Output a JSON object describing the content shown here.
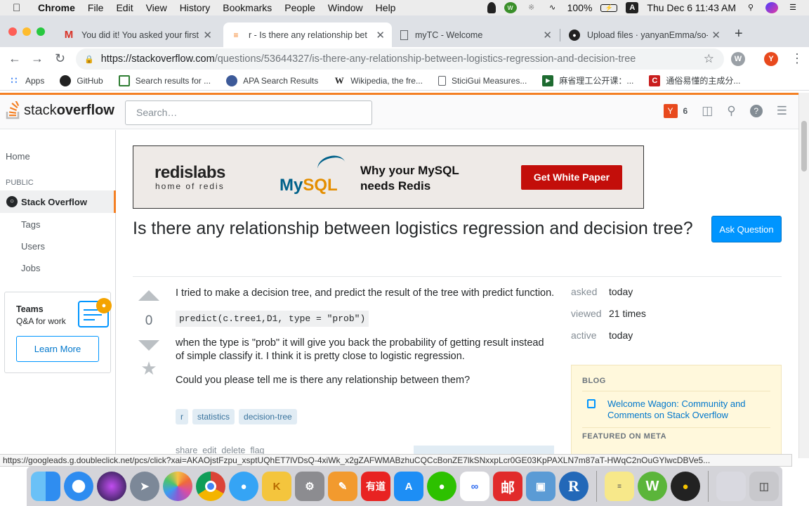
{
  "menubar": {
    "app": "Chrome",
    "items": [
      "File",
      "Edit",
      "View",
      "History",
      "Bookmarks",
      "People",
      "Window",
      "Help"
    ],
    "battery": "100%",
    "input_source": "A",
    "clock": "Thu Dec 6  11:43 AM"
  },
  "tabs": [
    {
      "title": "You did it! You asked your first",
      "icon": "gmail-icon"
    },
    {
      "title": "r - Is there any relationship bet",
      "icon": "stackoverflow-icon"
    },
    {
      "title": "myTC - Welcome",
      "icon": "document-icon"
    },
    {
      "title": "Upload files · yanyanEmma/so-",
      "icon": "github-icon"
    }
  ],
  "address": {
    "host": "https://stackoverflow.com",
    "path": "/questions/53644327/is-there-any-relationship-between-logistics-regression-and-decision-tree"
  },
  "profile_initial": "Y",
  "extension_initial": "W",
  "bookmarks": [
    {
      "label": "Apps",
      "icon": "apps-grid-icon"
    },
    {
      "label": "GitHub",
      "icon": "github-icon"
    },
    {
      "label": "Search results for ...",
      "icon": "grid-icon"
    },
    {
      "label": "APA Search Results",
      "icon": "apa-icon"
    },
    {
      "label": "Wikipedia, the fre...",
      "icon": "wikipedia-icon"
    },
    {
      "label": "SticiGui Measures...",
      "icon": "document-icon"
    },
    {
      "label": "麻省理工公开课：...",
      "icon": "play-icon"
    },
    {
      "label": "通俗易懂的主成分...",
      "icon": "csdn-icon"
    }
  ],
  "so": {
    "logo_light": "stack",
    "logo_bold": "overflow",
    "search_placeholder": "Search…",
    "avatar_letter": "Y",
    "reputation": "6",
    "nav": {
      "home": "Home",
      "public": "PUBLIC",
      "stack_overflow": "Stack Overflow",
      "tags": "Tags",
      "users": "Users",
      "jobs": "Jobs"
    },
    "teams": {
      "title": "Teams",
      "subtitle": "Q&A for work",
      "button": "Learn More"
    }
  },
  "ad": {
    "brand": "redislabs",
    "tagline": "home of redis",
    "mysql_text": "My",
    "mysql_bold": "SQL",
    "headline": "Why your MySQL needs Redis",
    "cta": "Get White Paper"
  },
  "question": {
    "title": "Is there any relationship between logistics regression and decision tree?",
    "ask_button": "Ask Question",
    "score": "0",
    "body_1": "I tried to make a decision tree, and predict the result of the tree with predict function.",
    "code": "predict(c.tree1,D1, type = \"prob\")",
    "body_2": "when the type is \"prob\" it will give you back the probability of getting result instead of simple classify it. I think it is pretty close to logistic regression.",
    "body_3": "Could you please tell me is there any relationship between them?",
    "tags": [
      "r",
      "statistics",
      "decision-tree"
    ],
    "post_menu": "share  edit  delete  flag"
  },
  "stats": [
    {
      "label": "asked",
      "value": "today"
    },
    {
      "label": "viewed",
      "value": "21 times"
    },
    {
      "label": "active",
      "value": "today"
    }
  ],
  "sidebar_blog": {
    "heading": "BLOG",
    "link": "Welcome Wagon: Community and Comments on Stack Overflow",
    "featured": "FEATURED ON META"
  },
  "status_url": "https://googleads.g.doubleclick.net/pcs/click?xai=AKAOjstFzpu_xsptUQhET7lVDsQ-4xiWk_x2gZAFWMABzhuCQCcBonZE7lkSNxxpLcr0GE03KpPAXLN7m87aT-HWqC2nOuGYlwcDBVe5...",
  "dock": [
    "finder-icon",
    "safari-icon",
    "siri-icon",
    "launchpad-icon",
    "photos-icon",
    "chrome-icon",
    "messages-icon",
    "keka-icon",
    "system-preferences-icon",
    "pages-icon",
    "youdao-icon",
    "app-store-icon",
    "wechat-icon",
    "baidu-netdisk-icon",
    "mail-icon",
    "preview-icon",
    "r-icon",
    "stickies-icon",
    "wps-icon",
    "qq-icon",
    "document-icon",
    "trash-icon"
  ],
  "dock_labels": {
    "youdao": "有道",
    "mail": "邮",
    "r": "R",
    "wps": "W"
  },
  "colors": {
    "so_orange": "#f48024",
    "so_blue": "#0095ff",
    "link_blue": "#0077cc",
    "tag_bg": "#e1ecf4",
    "tag_text": "#39739d",
    "ad_red": "#c30e0a"
  }
}
